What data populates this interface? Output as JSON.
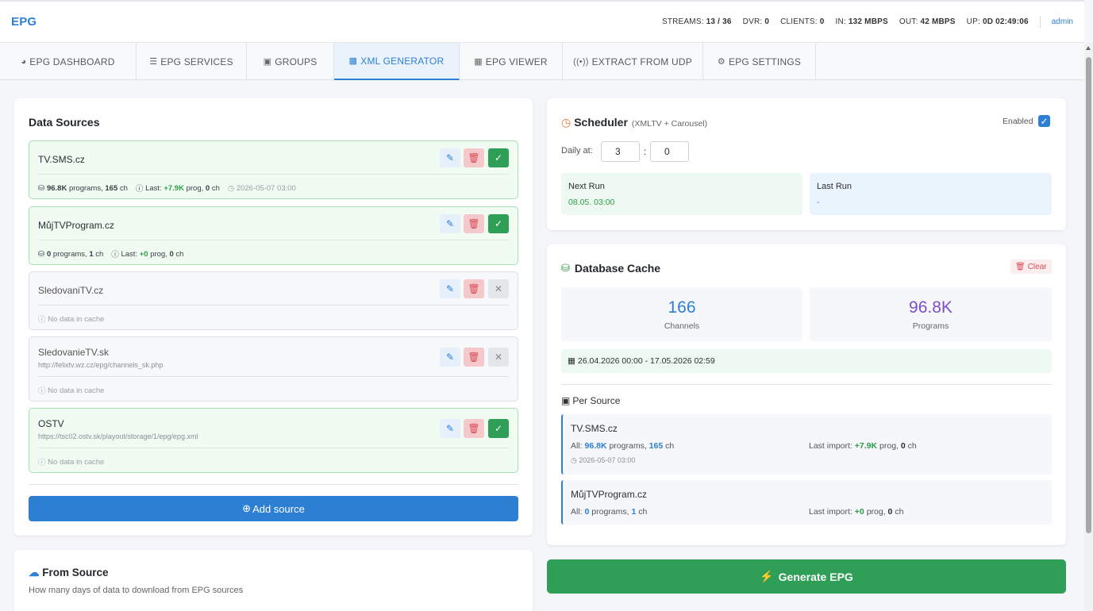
{
  "header": {
    "brand": "EPG",
    "stats": [
      {
        "label": "STREAMS:",
        "value": "13 / 36"
      },
      {
        "label": "DVR:",
        "value": "0"
      },
      {
        "label": "CLIENTS:",
        "value": "0"
      },
      {
        "label": "IN:",
        "value": "132 MBPS"
      },
      {
        "label": "OUT:",
        "value": "42 MBPS"
      },
      {
        "label": "UP:",
        "value": "0D 02:49:06"
      }
    ],
    "user": "admin"
  },
  "tabs": [
    {
      "icon": "dashboard-icon",
      "label": "EPG DASHBOARD"
    },
    {
      "icon": "list-icon",
      "label": "EPG SERVICES"
    },
    {
      "icon": "box-icon",
      "label": "GROUPS"
    },
    {
      "icon": "code-file-icon",
      "label": "XML GENERATOR"
    },
    {
      "icon": "calendar-grid-icon",
      "label": "EPG VIEWER"
    },
    {
      "icon": "broadcast-icon",
      "label": "EXTRACT FROM UDP"
    },
    {
      "icon": "gear-icon",
      "label": "EPG SETTINGS"
    }
  ],
  "data_sources": {
    "title": "Data Sources",
    "no_data_text": "No data in cache",
    "programs_word": "programs,",
    "ch_word": "ch",
    "last_word": "Last:",
    "prog_word": "prog,",
    "items": [
      {
        "name": "TV.SMS.cz",
        "enabled": true,
        "programs": "96.8K",
        "channels": "165",
        "last_prog": "+7.9K",
        "last_ch": "0",
        "timestamp": "2026-05-07 03:00"
      },
      {
        "name": "MůjTVProgram.cz",
        "enabled": true,
        "programs": "0",
        "channels": "1",
        "last_prog": "+0",
        "last_ch": "0"
      },
      {
        "name": "SledovaniTV.cz",
        "enabled": false
      },
      {
        "name": "SledovanieTV.sk",
        "url": "http://felixtv.wz.cz/epg/channels_sk.php",
        "enabled": false
      },
      {
        "name": "OSTV",
        "url": "https://tsc02.ostv.sk/playout/storage/1/epg/epg.xml",
        "enabled": true
      }
    ],
    "add_label": "Add source"
  },
  "from_source": {
    "title": "From Source",
    "description": "How many days of data to download from EPG sources"
  },
  "scheduler": {
    "title": "Scheduler",
    "subtitle": "(XMLTV + Carousel)",
    "enabled_label": "Enabled",
    "enabled": true,
    "daily_label": "Daily at:",
    "hour": "3",
    "separator": ":",
    "minute": "0",
    "next_run_label": "Next Run",
    "next_run_value": "08.05. 03:00",
    "last_run_label": "Last Run",
    "last_run_value": "-"
  },
  "cache": {
    "title": "Database Cache",
    "clear_label": "Clear",
    "channels_count": "166",
    "channels_label": "Channels",
    "programs_count": "96.8K",
    "programs_label": "Programs",
    "range": "26.04.2026 00:00 - 17.05.2026 02:59",
    "per_source_title": "Per Source",
    "all_label": "All:",
    "programs_word": "programs,",
    "ch_word": "ch",
    "last_import_label": "Last import:",
    "prog_word": "prog,",
    "sources": [
      {
        "name": "TV.SMS.cz",
        "programs": "96.8K",
        "channels": "165",
        "last_prog": "+7.9K",
        "last_ch": "0",
        "timestamp": "2026-05-07 03:00"
      },
      {
        "name": "MůjTVProgram.cz",
        "programs": "0",
        "channels": "1",
        "last_prog": "+0",
        "last_ch": "0"
      }
    ]
  },
  "generate_label": "Generate EPG",
  "colors": {
    "accent": "#2d7fd3",
    "success": "#2f9e57",
    "danger": "#d84a55",
    "programs": "#7b4fc9"
  }
}
